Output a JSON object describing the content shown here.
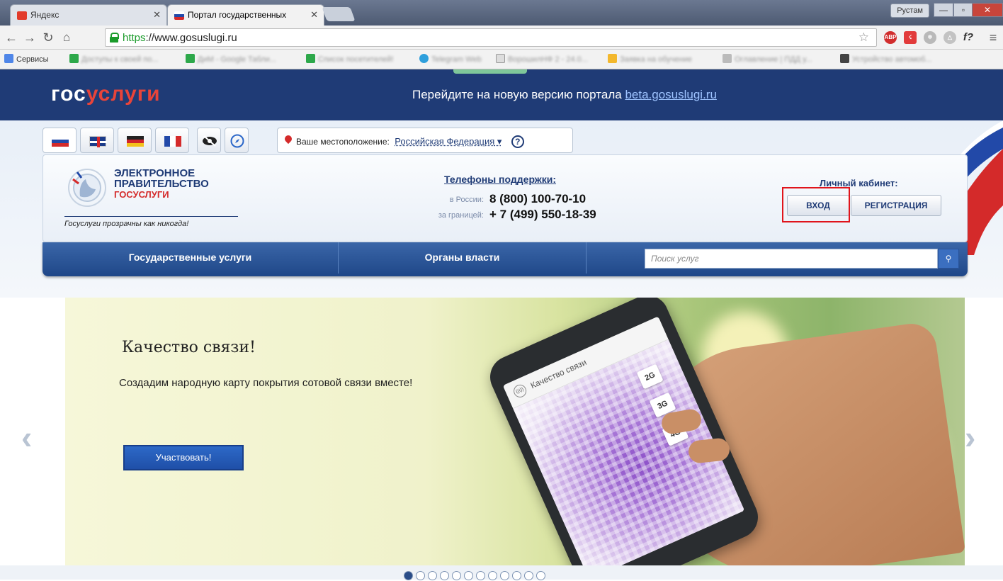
{
  "browser": {
    "tabs": [
      {
        "label": "Яндекс",
        "active": false
      },
      {
        "label": "Портал государственных",
        "active": true
      }
    ],
    "user": "Рустам",
    "url": "https://www.gosuslugi.ru",
    "url_scheme": "https",
    "url_host": "://www.gosuslugi.ru",
    "bookmarks": [
      "Сервисы",
      "Доступы к своей по...",
      "ДиМ - Google Табли...",
      "Список посетителей!",
      "Telegram Web",
      "ВорошилНФ 2 - 24.0...",
      "Заявка на обучение",
      "Оглавление | ПДД у...",
      "Устройство автомоб..."
    ]
  },
  "banner": {
    "logo_part1": "гос",
    "logo_part2": "услуги",
    "text": "Перейдите на новую версию портала",
    "link": "beta.gosuslugi.ru"
  },
  "header": {
    "location_label": "Ваше местоположение:",
    "location_value": "Российская Федерация",
    "help": "?",
    "eg_line1": "ЭЛЕКТРОННОЕ",
    "eg_line2": "ПРАВИТЕЛЬСТВО",
    "eg_line3": "ГОСУСЛУГИ",
    "slogan": "Госуслуги прозрачны как никогда!",
    "phones_title": "Телефоны поддержки:",
    "phone_ru_label": "в России:",
    "phone_ru": "8 (800) 100-70-10",
    "phone_abroad_label": "за границей:",
    "phone_abroad": "+ 7 (499) 550-18-39",
    "cabinet_title": "Личный кабинет:",
    "login": "ВХОД",
    "register": "РЕГИСТРАЦИЯ"
  },
  "nav": {
    "services": "Государственные услуги",
    "authorities": "Органы власти",
    "search_placeholder": "Поиск услуг"
  },
  "slide": {
    "title": "Качество связи!",
    "subtitle": "Создадим народную карту покрытия сотовой связи вместе!",
    "button": "Участвовать!",
    "screen_title": "Качество связи",
    "gens": [
      "2G",
      "3G",
      "4G"
    ]
  },
  "pager": {
    "count": 12,
    "active_index": 0
  }
}
